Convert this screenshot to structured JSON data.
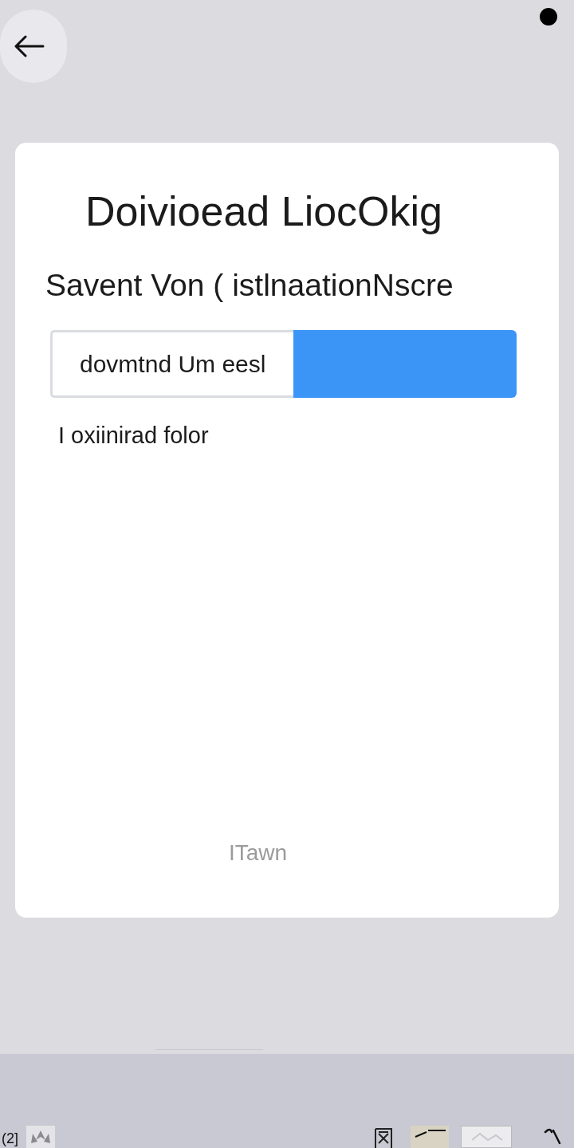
{
  "dialog": {
    "title": "Doivioead LiocOkig",
    "subtitle": "Savent Von ( istlnaationNscre",
    "path_field": {
      "value": "dovmtnd Um eesl"
    },
    "field_label": "I oxiinirad folor",
    "footer_link": "ITawn"
  },
  "bottom_bar": {
    "label": "(2]"
  }
}
